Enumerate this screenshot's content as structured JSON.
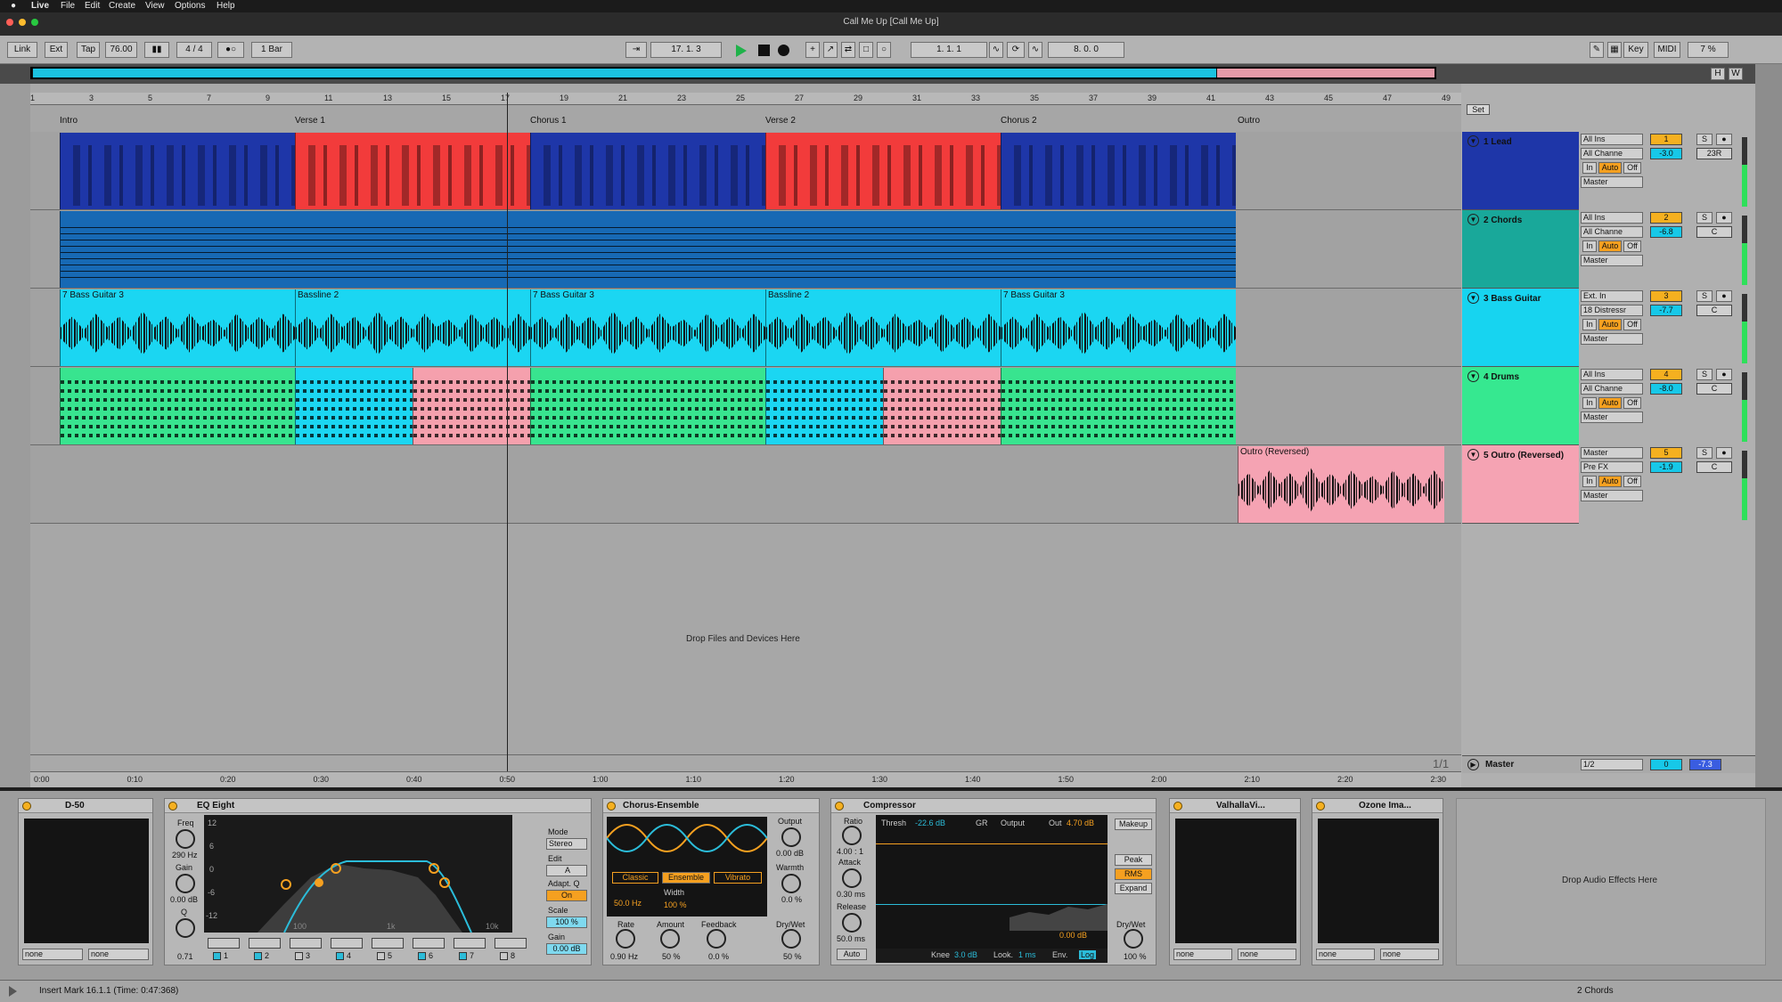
{
  "menubar": {
    "items": [
      "Live",
      "File",
      "Edit",
      "Create",
      "View",
      "Options",
      "Help"
    ]
  },
  "window": {
    "title": "Call Me Up  [Call Me Up]"
  },
  "transport": {
    "link": "Link",
    "ext": "Ext",
    "tap": "Tap",
    "tempo": "76.00",
    "signature": "4 / 4",
    "quant": "1 Bar",
    "position": "17.  1.  3",
    "loop_start": "1.  1.  1",
    "loop_length": "8.  0.  0",
    "key": "Key",
    "midi": "MIDI",
    "cpu": "7 %",
    "h": "H",
    "w": "W"
  },
  "ruler": {
    "bars": [
      "1",
      "3",
      "5",
      "7",
      "9",
      "11",
      "13",
      "15",
      "17",
      "19",
      "21",
      "23",
      "25",
      "27",
      "29",
      "31",
      "33",
      "35",
      "37",
      "39",
      "41",
      "43",
      "45",
      "47",
      "49"
    ],
    "set": "Set"
  },
  "locators": [
    "Intro",
    "Verse 1",
    "Chorus 1",
    "Verse 2",
    "Chorus 2",
    "Outro"
  ],
  "clips": {
    "bass_a": "7 Bass Guitar 3",
    "bass_b": "Bassline 2",
    "outro": "Outro (Reversed)"
  },
  "drop_files": "Drop Files and Devices Here",
  "tracks": [
    {
      "name": "1 Lead",
      "input": "All Ins",
      "channel": "All Channe",
      "in": "In",
      "auto": "Auto",
      "off": "Off",
      "out": "Master",
      "num": "1",
      "s": "S",
      "vol": "-3.0",
      "pan": "23R",
      "color": "#1e36a8"
    },
    {
      "name": "2 Chords",
      "input": "All Ins",
      "channel": "All Channe",
      "in": "In",
      "auto": "Auto",
      "off": "Off",
      "out": "Master",
      "num": "2",
      "s": "S",
      "vol": "-6.8",
      "pan": "C",
      "color": "#19a89a"
    },
    {
      "name": "3 Bass Guitar",
      "input": "Ext. In",
      "channel": "18 Distressr",
      "in": "In",
      "auto": "Auto",
      "off": "Off",
      "out": "Master",
      "num": "3",
      "s": "S",
      "vol": "-7.7",
      "pan": "C",
      "color": "#17d4f0"
    },
    {
      "name": "4 Drums",
      "input": "All Ins",
      "channel": "All Channe",
      "in": "In",
      "auto": "Auto",
      "off": "Off",
      "out": "Master",
      "num": "4",
      "s": "S",
      "vol": "-8.0",
      "pan": "C",
      "color": "#36e890"
    },
    {
      "name": "5 Outro (Reversed)",
      "input": "Master",
      "channel": "Pre FX",
      "in": "In",
      "auto": "Auto",
      "off": "Off",
      "out": "Master",
      "num": "5",
      "s": "S",
      "vol": "-1.9",
      "pan": "C",
      "color": "#f5a3b3"
    }
  ],
  "master": {
    "name": "Master",
    "ratio": "1/1",
    "cue": "1/2",
    "vol": "0",
    "pan": "-7.3"
  },
  "timeline": [
    "0:00",
    "0:10",
    "0:20",
    "0:30",
    "0:40",
    "0:50",
    "1:00",
    "1:10",
    "1:20",
    "1:30",
    "1:40",
    "1:50",
    "2:00",
    "2:10",
    "2:20",
    "2:30"
  ],
  "devices": {
    "d50": {
      "name": "D-50",
      "a": "none",
      "b": "none"
    },
    "eq": {
      "name": "EQ Eight",
      "freq_label": "Freq",
      "freq": "290 Hz",
      "gain_label": "Gain",
      "gain": "0.00 dB",
      "q_label": "Q",
      "q": "0.71",
      "db": [
        "12",
        "6",
        "0",
        "-6",
        "-12"
      ],
      "freqs": [
        "100",
        "1k",
        "10k"
      ],
      "mode_label": "Mode",
      "mode": "Stereo",
      "edit_label": "Edit",
      "edit": "A",
      "adapt_label": "Adapt. Q",
      "adapt": "On",
      "scale_label": "Scale",
      "scale": "100 %",
      "outgain_label": "Gain",
      "outgain": "0.00 dB",
      "bands": [
        "1",
        "2",
        "3",
        "4",
        "5",
        "6",
        "7",
        "8"
      ]
    },
    "chorus": {
      "name": "Chorus-Ensemble",
      "classic": "Classic",
      "ensemble": "Ensemble",
      "vibrato": "Vibrato",
      "hz": "50.0 Hz",
      "width_label": "Width",
      "width": "100 %",
      "output_label": "Output",
      "output": "0.00 dB",
      "warmth_label": "Warmth",
      "warmth": "0.0 %",
      "rate_label": "Rate",
      "rate": "0.90 Hz",
      "amount_label": "Amount",
      "amount": "50 %",
      "feedback_label": "Feedback",
      "feedback": "0.0 %",
      "drywet_label": "Dry/Wet",
      "drywet": "50 %"
    },
    "comp": {
      "name": "Compressor",
      "ratio_label": "Ratio",
      "ratio": "4.00 : 1",
      "attack_label": "Attack",
      "attack": "0.30 ms",
      "release_label": "Release",
      "release": "50.0 ms",
      "auto": "Auto",
      "thresh": "Thresh",
      "thresh_val": "-22.6 dB",
      "gr": "GR",
      "output_chk": "Output",
      "out": "Out",
      "out_val": "4.70 dB",
      "meter": "0.00 dB",
      "makeup": "Makeup",
      "peak": "Peak",
      "rms": "RMS",
      "expand": "Expand",
      "knee": "Knee",
      "knee_val": "3.0 dB",
      "look": "Look.",
      "look_val": "1 ms",
      "env": "Env.",
      "log": "Log",
      "drywet_label": "Dry/Wet",
      "drywet": "100 %"
    },
    "valhalla": {
      "name": "ValhallaVi...",
      "a": "none",
      "b": "none"
    },
    "ozone": {
      "name": "Ozone Ima...",
      "a": "none",
      "b": "none"
    },
    "drop": "Drop Audio Effects Here"
  },
  "status": {
    "message": "Insert Mark 16.1.1 (Time: 0:47:368)",
    "track": "2 Chords"
  }
}
